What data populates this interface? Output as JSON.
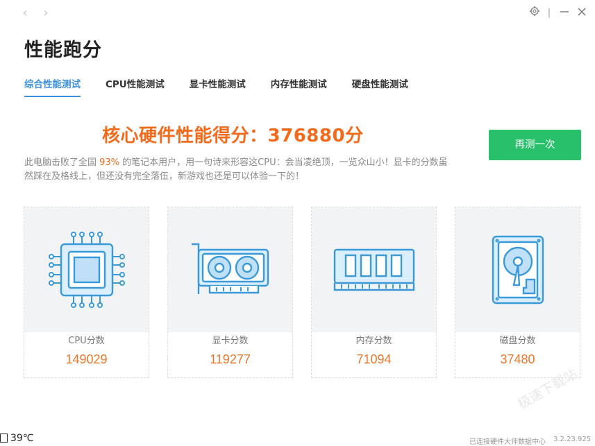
{
  "window": {
    "settings_icon": "gear-icon",
    "separator": "|",
    "minimize_icon": "minimize-icon",
    "close_icon": "close-icon"
  },
  "nav": {
    "back_icon": "chevron-left-icon",
    "forward_icon": "chevron-right-icon"
  },
  "page_title": "性能跑分",
  "tabs": [
    {
      "label": "综合性能测试",
      "active": true
    },
    {
      "label": "CPU性能测试",
      "active": false
    },
    {
      "label": "显卡性能测试",
      "active": false
    },
    {
      "label": "内存性能测试",
      "active": false
    },
    {
      "label": "硬盘性能测试",
      "active": false
    }
  ],
  "headline": {
    "prefix": "核心硬件性能得分：",
    "score": "376880",
    "suffix": "分"
  },
  "retest_label": "再测一次",
  "summary": {
    "part1": "此电脑击败了全国 ",
    "percent": "93%",
    "part2": " 的笔记本用户，用一句诗来形容这CPU：会当凌绝顶，一览众山小！显卡的分数虽然踩在及格线上，但还没有完全落伍，新游戏也还是可以体验一下的！"
  },
  "cards": [
    {
      "label": "CPU分数",
      "score": "149029",
      "icon": "cpu-chip-icon"
    },
    {
      "label": "显卡分数",
      "score": "119277",
      "icon": "graphics-card-icon"
    },
    {
      "label": "内存分数",
      "score": "71094",
      "icon": "memory-module-icon"
    },
    {
      "label": "磁盘分数",
      "score": "37480",
      "icon": "hard-disk-icon"
    }
  ],
  "watermark": "极速下载站",
  "footer": {
    "temperature": "39℃",
    "status": "已连接硬件大师数据中心",
    "version": "3.2.23.925"
  },
  "colors": {
    "accent_blue": "#3b8fe0",
    "score_orange": "#f26b1d",
    "button_green": "#29c06b",
    "icon_blue": "#3a9ad9"
  }
}
